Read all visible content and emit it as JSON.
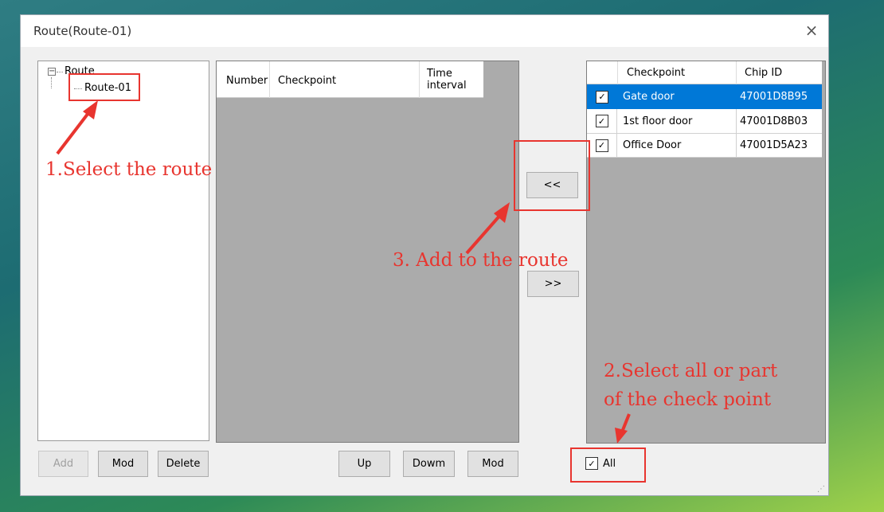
{
  "window": {
    "title": "Route(Route-01)",
    "close_glyph": "×"
  },
  "tree": {
    "root": "Route",
    "child": "Route-01"
  },
  "route_table": {
    "headers": [
      "Number",
      "Checkpoint",
      "Time interval"
    ]
  },
  "transfer": {
    "add": "<<",
    "remove": ">>"
  },
  "checkpoint_table": {
    "headers": [
      "Checkpoint",
      "Chip ID"
    ],
    "rows": [
      {
        "checked": true,
        "checkpoint": "Gate door",
        "chip_id": "47001D8B95",
        "selected": true
      },
      {
        "checked": true,
        "checkpoint": "1st floor door",
        "chip_id": "47001D8B03",
        "selected": false
      },
      {
        "checked": true,
        "checkpoint": "Office Door",
        "chip_id": "47001D5A23",
        "selected": false
      }
    ]
  },
  "buttons": {
    "add": "Add",
    "mod": "Mod",
    "delete": "Delete",
    "up": "Up",
    "down": "Dowm",
    "mod2": "Mod"
  },
  "all": {
    "label": "All",
    "checked": true
  },
  "annotations": {
    "step1": "1.Select the route",
    "step2_line1": "2.Select all or part",
    "step2_line2": "of the check point",
    "step3": "3. Add to the route"
  },
  "colors": {
    "annotation": "#e8352f",
    "selection": "#0078d7"
  }
}
